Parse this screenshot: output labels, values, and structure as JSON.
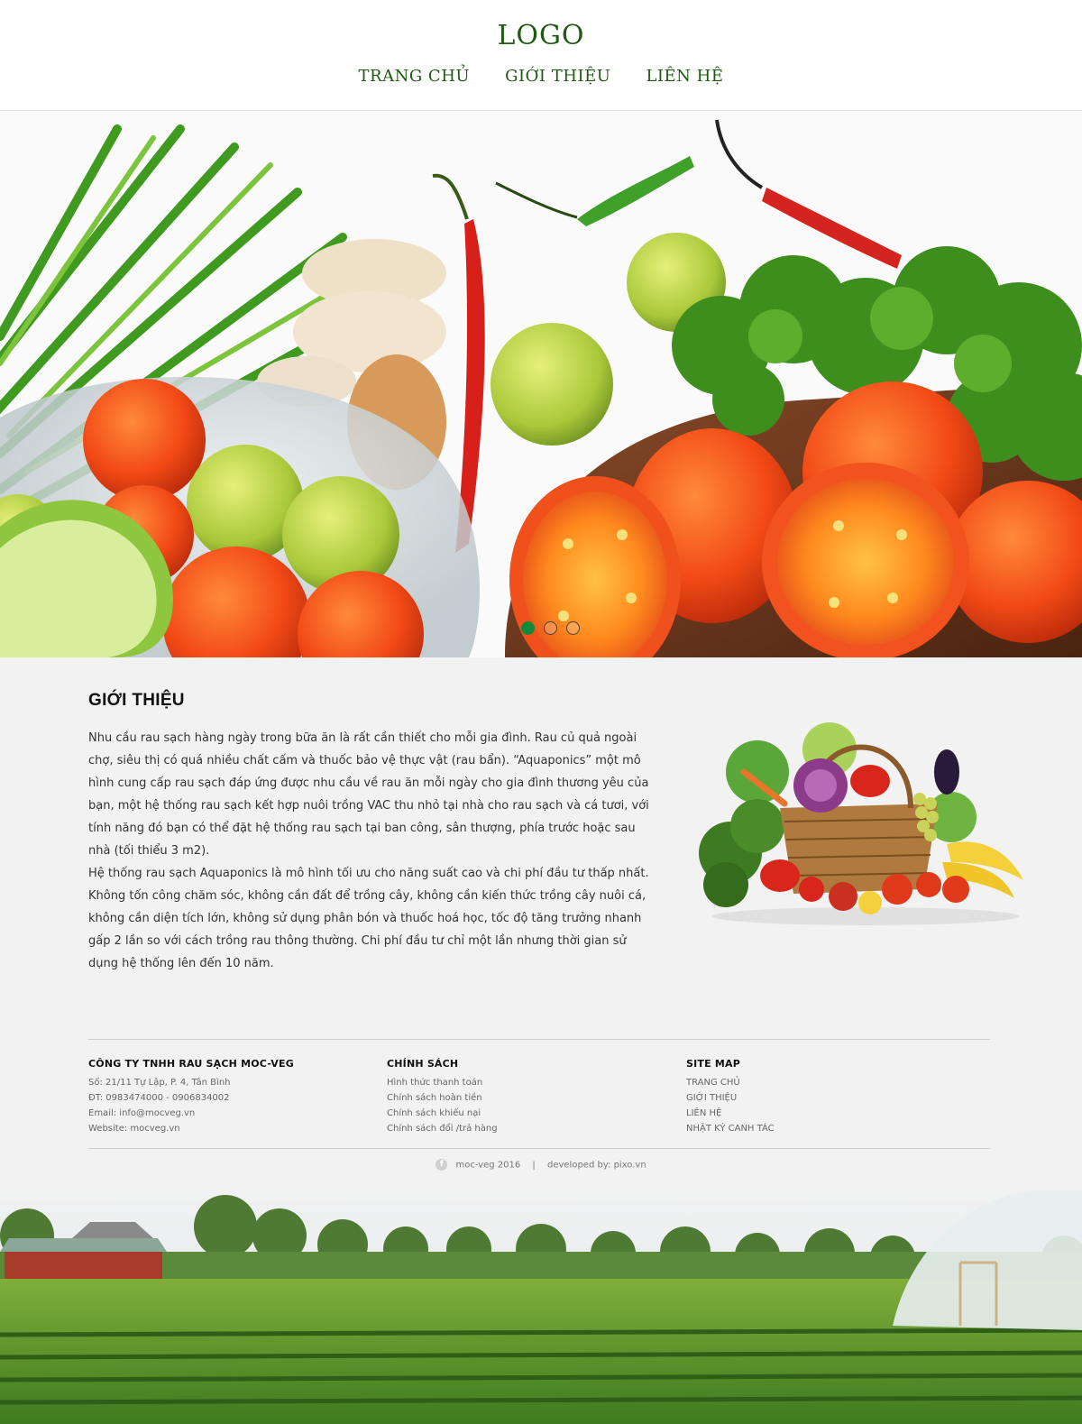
{
  "header": {
    "logo": "LOGO",
    "nav": [
      "TRANG CHỦ",
      "GIỚI THIỆU",
      "LIÊN HỆ"
    ]
  },
  "slider": {
    "slide_count": 3,
    "active_index": 0
  },
  "intro": {
    "title": "GIỚI THIỆU",
    "paragraph1": "Nhu cầu rau sạch hàng ngày trong bữa ăn là rất cần thiết cho mỗi gia đình. Rau củ quả ngoài chợ, siêu thị có quá nhiều chất cấm và thuốc bảo vệ thực vật (rau bẩn). “Aquaponics” một mô hình cung cấp rau sạch đáp ứng được nhu cầu về rau ăn mỗi ngày cho gia đình thương yêu của bạn, một hệ thống rau sạch kết hợp nuôi trồng VAC thu nhỏ tại nhà cho rau sạch và cá tươi, với tính năng đó bạn có thể đặt hệ thống rau sạch tại ban công, sân thượng, phía trước hoặc sau nhà (tối thiểu 3 m2).",
    "paragraph2": "Hệ thống rau sạch Aquaponics là mô hình tối ưu cho năng suất cao và chi phí đầu tư thấp nhất. Không tốn công chăm sóc, không cần đất để trồng cây, không cần kiến thức trồng cây nuôi cá, không cần diện tích lớn, không sử dụng phân bón và thuốc hoá học, tốc độ tăng trưởng nhanh gấp 2 lần so với cách trồng rau thông thường. Chi phí đầu tư chỉ một lần nhưng thời gian sử dụng hệ thống lên đến 10 năm."
  },
  "footer": {
    "company": {
      "title": "CÔNG TY TNHH RAU SẠCH MOC-VEG",
      "address": "Số: 21/11 Tự Lập, P. 4, Tân Bình",
      "phone": "ĐT: 0983474000 - 0906834002",
      "email": "Email: info@mocveg.vn",
      "website": "Website: mocveg.vn"
    },
    "policy": {
      "title": "CHÍNH SÁCH",
      "items": [
        "Hình thức thanh toán",
        "Chính sách hoàn tiền",
        "Chính sách khiếu nại",
        "Chính sách đổi /trả hàng"
      ]
    },
    "sitemap": {
      "title": "SITE MAP",
      "items": [
        "TRANG CHỦ",
        "GIỚI THIỆU",
        "LIÊN HỆ",
        "NHẬT KÝ CANH TÁC"
      ]
    },
    "copyright": "moc-veg 2016",
    "separator": "|",
    "developer": "developed by: pixo.vn",
    "facebook_glyph": "f"
  },
  "icons": {
    "facebook": "facebook-icon"
  },
  "colors": {
    "brand_green": "#1e5a12",
    "active_dot": "#0e8a3a"
  }
}
